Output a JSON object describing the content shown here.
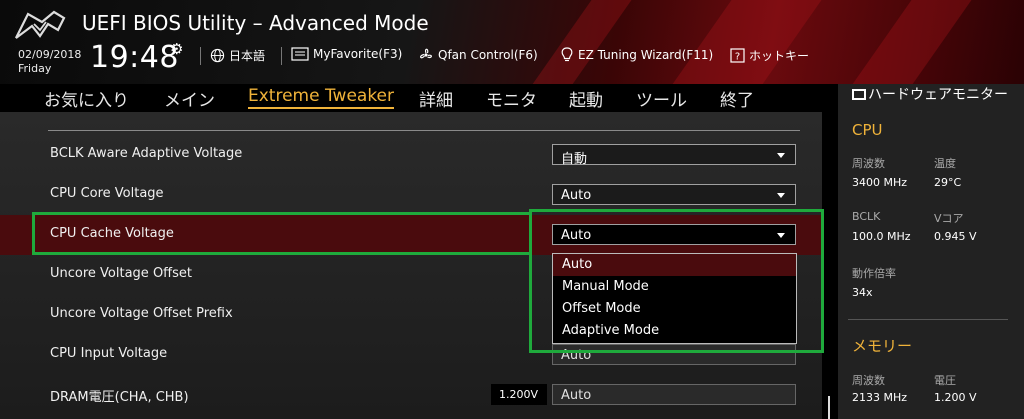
{
  "app": {
    "title": "UEFI BIOS Utility – Advanced Mode"
  },
  "datetime": {
    "date": "02/09/2018",
    "day": "Friday",
    "time": "19:48"
  },
  "toolbar": [
    {
      "icon": "globe-icon",
      "label": "日本語"
    },
    {
      "icon": "star-list-icon",
      "label": "MyFavorite(F3)"
    },
    {
      "icon": "fan-icon",
      "label": "Qfan Control(F6)"
    },
    {
      "icon": "bulb-icon",
      "label": "EZ Tuning Wizard(F11)"
    },
    {
      "icon": "help-icon",
      "label": "ホットキー"
    }
  ],
  "nav": [
    {
      "label": "お気に入り"
    },
    {
      "label": "メイン"
    },
    {
      "label": "Extreme Tweaker",
      "active": true
    },
    {
      "label": "詳細"
    },
    {
      "label": "モニタ"
    },
    {
      "label": "起動"
    },
    {
      "label": "ツール"
    },
    {
      "label": "終了"
    }
  ],
  "settings": [
    {
      "label": "BCLK Aware Adaptive Voltage",
      "value": "自動",
      "type": "dropdown"
    },
    {
      "label": "CPU Core Voltage",
      "value": "Auto",
      "type": "dropdown"
    },
    {
      "label": "CPU Cache Voltage",
      "value": "Auto",
      "type": "dropdown",
      "selected": true
    },
    {
      "label": "Uncore Voltage Offset"
    },
    {
      "label": "Uncore Voltage Offset Prefix"
    },
    {
      "label": "CPU Input Voltage",
      "value": "Auto",
      "type": "field"
    },
    {
      "label": "DRAM電圧(CHA, CHB)",
      "value": "Auto",
      "type": "field",
      "voltage": "1.200V"
    }
  ],
  "dropdown_menu": {
    "options": [
      "Auto",
      "Manual Mode",
      "Offset Mode",
      "Adaptive Mode"
    ],
    "highlighted": "Auto"
  },
  "hardware_monitor": {
    "title": "ハードウェアモニター",
    "cpu": {
      "heading": "CPU",
      "freq_label": "周波数",
      "freq_value": "3400 MHz",
      "temp_label": "温度",
      "temp_value": "29°C",
      "bclk_label": "BCLK",
      "bclk_value": "100.0 MHz",
      "vcore_label": "Vコア",
      "vcore_value": "0.945 V",
      "ratio_label": "動作倍率",
      "ratio_value": "34x"
    },
    "memory": {
      "heading": "メモリー",
      "freq_label": "周波数",
      "freq_value": "2133 MHz",
      "volt_label": "電圧",
      "volt_value": "1.200 V"
    }
  },
  "colors": {
    "accent": "#f0b33a",
    "selection": "#4a0b0d",
    "annotation": "#1faa3c"
  }
}
